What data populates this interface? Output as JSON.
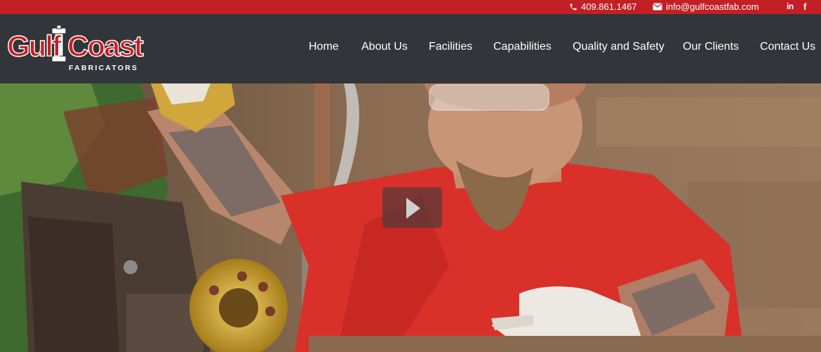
{
  "topbar": {
    "phone": "409.861.1467",
    "email": "info@gulfcoastfab.com",
    "social": {
      "linkedin": "in",
      "facebook": "f"
    },
    "icons": {
      "phone": "phone-icon",
      "email": "envelope-icon",
      "linkedin": "linkedin-icon",
      "facebook": "facebook-icon"
    }
  },
  "logo": {
    "word1": "Gulf",
    "word2": "Coast",
    "tagline": "FABRICATORS"
  },
  "nav": {
    "items": [
      {
        "label": "Home"
      },
      {
        "label": "About Us"
      },
      {
        "label": "Facilities"
      },
      {
        "label": "Capabilities"
      },
      {
        "label": "Quality and Safety"
      },
      {
        "label": "Our Clients"
      },
      {
        "label": "Contact Us"
      }
    ]
  },
  "hero": {
    "play_icon": "play-icon"
  },
  "colors": {
    "brand_red": "#c22026",
    "header_bg": "#323539",
    "nav_text": "#ffffff"
  }
}
